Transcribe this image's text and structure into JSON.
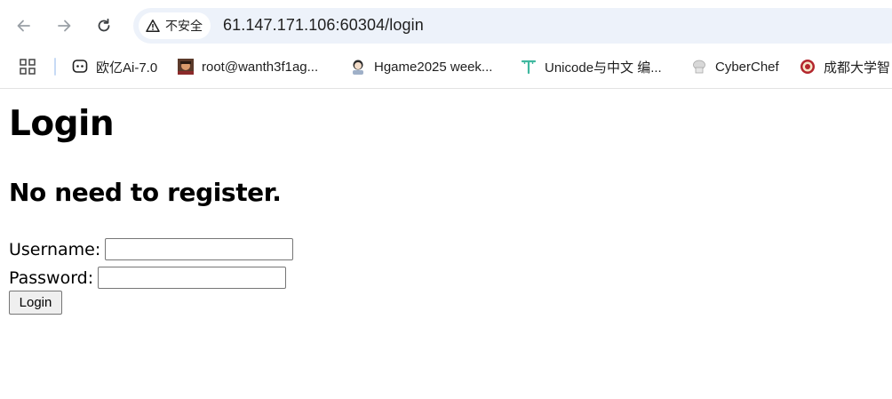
{
  "browser": {
    "security_label": "不安全",
    "url": "61.147.171.106:60304/login",
    "bookmarks": [
      {
        "label": "欧亿Ai-7.0",
        "icon": "chat-bot-icon"
      },
      {
        "label": "root@wanth3f1ag...",
        "icon": "avatar-photo-icon"
      },
      {
        "label": "Hgame2025 week...",
        "icon": "avatar-anime-icon"
      },
      {
        "label": "Unicode与中文 编...",
        "icon": "t-logo-icon"
      },
      {
        "label": "CyberChef",
        "icon": "chef-hat-icon"
      },
      {
        "label": "成都大学智",
        "icon": "university-seal-icon"
      }
    ]
  },
  "page": {
    "title": "Login",
    "subtitle": "No need to register.",
    "username_label": "Username:",
    "password_label": "Password:",
    "username_value": "",
    "password_value": "",
    "submit_label": "Login"
  },
  "colors": {
    "omnibox_bg": "#edf2fa",
    "text": "#1f1f1f",
    "button_bg": "#efefef",
    "input_border": "#767676"
  }
}
